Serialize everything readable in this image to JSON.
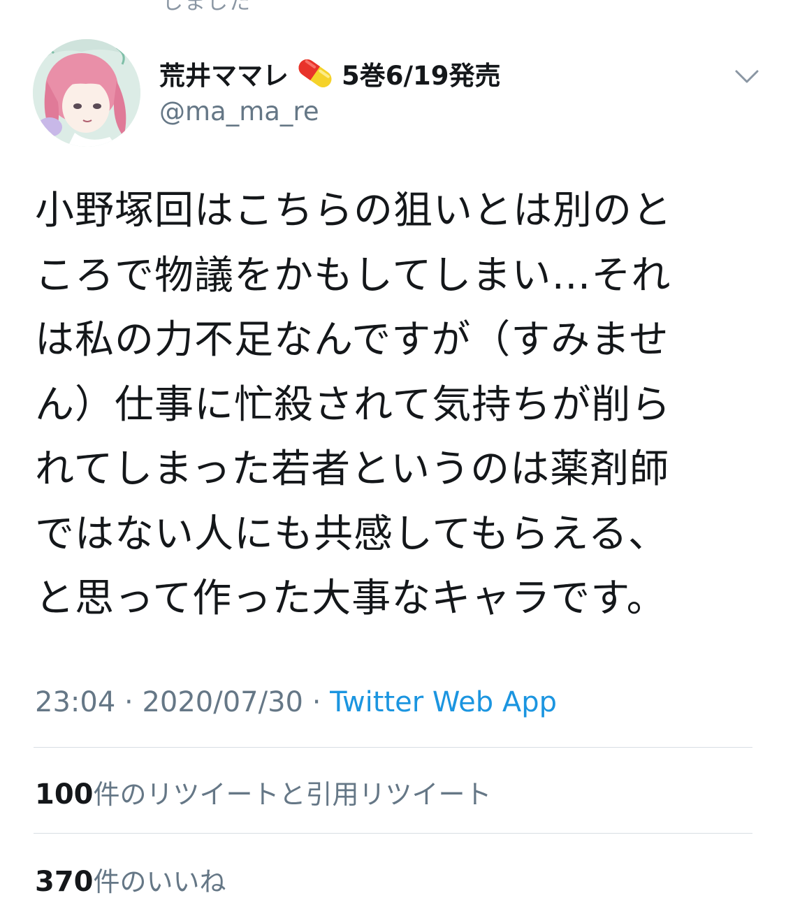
{
  "top_cutoff_text": "しました",
  "author": {
    "display_name_prefix": "荒井ママレ",
    "display_name_suffix": "5巻6/19発売",
    "emoji_icon": "pill-icon",
    "handle": "@ma_ma_re",
    "avatar_icon": "avatar-illustration"
  },
  "menu_icon": "chevron-down-icon",
  "tweet": {
    "lines": [
      "小野塚回はこちらの狙いとは別のと",
      "ころで物議をかもしてしまい…それ",
      "は私の力不足なんですが（すみませ",
      "ん）仕事に忙殺されて気持ちが削ら",
      "れてしまった若者というのは薬剤師",
      "ではない人にも共感してもらえる、",
      "と思って作った大事なキャラです。"
    ]
  },
  "meta": {
    "time": "23:04",
    "separator1": " · ",
    "date": "2020/07/30",
    "separator2": " · ",
    "source": "Twitter Web App"
  },
  "stats": {
    "retweets_count": "100",
    "retweets_label": "件のリツイートと引用リツイート",
    "likes_count": "370",
    "likes_label": "件のいいね"
  },
  "colors": {
    "text": "#14171a",
    "secondary": "#657786",
    "link": "#1b95e0",
    "divider": "#d8dee3"
  }
}
